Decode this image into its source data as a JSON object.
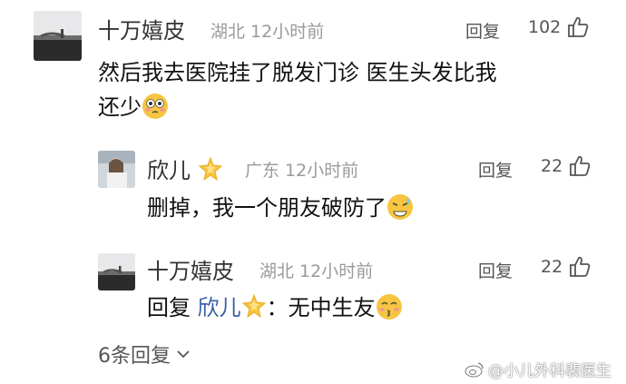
{
  "comment": {
    "username": "十万嬉皮",
    "location_time": "湖北 12小时前",
    "reply_label": "回复",
    "likes": "102",
    "text_line1": "然后我去医院挂了脱发门诊  医生头发比我",
    "text_line2": "还少"
  },
  "replies": [
    {
      "username": "欣儿",
      "location_time": "广东 12小时前",
      "reply_label": "回复",
      "likes": "22",
      "text": "删掉，我一个朋友破防了"
    },
    {
      "username": "十万嬉皮",
      "location_time": "湖北 12小时前",
      "reply_label": "回复",
      "likes": "22",
      "text_prefix": "回复 ",
      "mention": "欣儿",
      "text_suffix": "：无中生友"
    }
  ],
  "more_replies_label": "6条回复",
  "watermark": "@小儿外科裴医生",
  "icons": {
    "like": "thumbs-up-icon",
    "chevron": "chevron-down-icon",
    "badge": "star-badge-icon",
    "weibo": "weibo-logo-icon"
  }
}
